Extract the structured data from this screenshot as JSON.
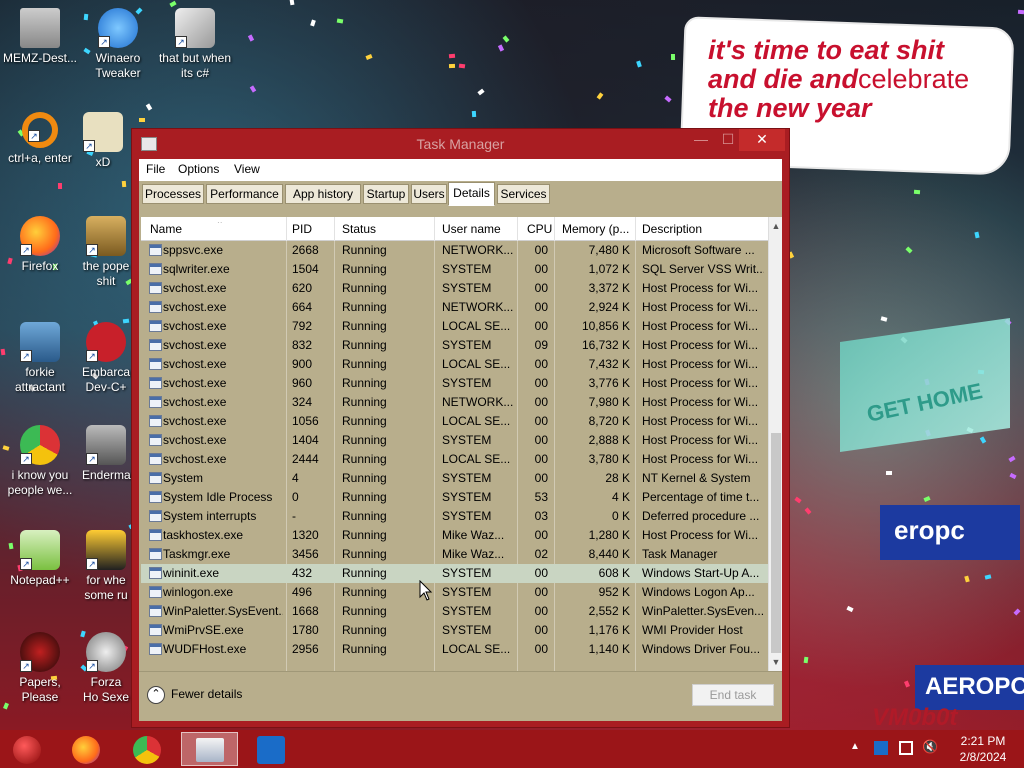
{
  "desktop": {
    "icons": [
      {
        "label": "MEMZ-Dest...",
        "icon": "recycle-bin-icon"
      },
      {
        "label": "Winaero Tweaker",
        "icon": "winaero-icon"
      },
      {
        "label": "that but when its c#",
        "icon": "stacked-windows-icon"
      },
      {
        "label": "ctrl+a, enter",
        "icon": "ring-icon"
      },
      {
        "label": "xD",
        "icon": "hxd-icon"
      },
      {
        "label": "Firefox",
        "icon": "firefox-icon"
      },
      {
        "label": "the pope shit",
        "icon": "pope-icon"
      },
      {
        "label": "forkie attractant",
        "icon": "settings-monitor-icon"
      },
      {
        "label": "Embarca Dev-C+",
        "icon": "devcpp-icon"
      },
      {
        "label": "i know you people we...",
        "icon": "chrome-icon"
      },
      {
        "label": "Enderma",
        "icon": "enderman-icon"
      },
      {
        "label": "Notepad++",
        "icon": "notepad-plus-icon"
      },
      {
        "label": "for whe some ru",
        "icon": "dj-icon"
      },
      {
        "label": "Papers, Please",
        "icon": "papers-please-icon"
      },
      {
        "label": "Forza Ho Sexe",
        "icon": "flash-icon"
      }
    ],
    "wallpaper_text": {
      "line1": "it's time to eat shit",
      "line2a": "and die and",
      "line2b": "celebrate",
      "line3": "the new year",
      "sign1": "GET HOME",
      "sign2": "eropc",
      "sign3": "AEROPOS",
      "watermark": "VM0b0t"
    }
  },
  "window": {
    "title": "Task Manager",
    "controls": {
      "minimize": "—",
      "maximize": "☐",
      "close": "✕"
    },
    "menu": [
      "File",
      "Options",
      "View"
    ],
    "tabs": [
      "Processes",
      "Performance",
      "App history",
      "Startup",
      "Users",
      "Details",
      "Services"
    ],
    "active_tab": "Details",
    "columns": [
      "Name",
      "PID",
      "Status",
      "User name",
      "CPU",
      "Memory (p...",
      "Description"
    ],
    "rows": [
      {
        "name": "sppsvc.exe",
        "pid": "2668",
        "status": "Running",
        "user": "NETWORK...",
        "cpu": "00",
        "memory": "7,480 K",
        "description": "Microsoft Software ..."
      },
      {
        "name": "sqlwriter.exe",
        "pid": "1504",
        "status": "Running",
        "user": "SYSTEM",
        "cpu": "00",
        "memory": "1,072 K",
        "description": "SQL Server VSS Writ..."
      },
      {
        "name": "svchost.exe",
        "pid": "620",
        "status": "Running",
        "user": "SYSTEM",
        "cpu": "00",
        "memory": "3,372 K",
        "description": "Host Process for Wi..."
      },
      {
        "name": "svchost.exe",
        "pid": "664",
        "status": "Running",
        "user": "NETWORK...",
        "cpu": "00",
        "memory": "2,924 K",
        "description": "Host Process for Wi..."
      },
      {
        "name": "svchost.exe",
        "pid": "792",
        "status": "Running",
        "user": "LOCAL SE...",
        "cpu": "00",
        "memory": "10,856 K",
        "description": "Host Process for Wi..."
      },
      {
        "name": "svchost.exe",
        "pid": "832",
        "status": "Running",
        "user": "SYSTEM",
        "cpu": "09",
        "memory": "16,732 K",
        "description": "Host Process for Wi..."
      },
      {
        "name": "svchost.exe",
        "pid": "900",
        "status": "Running",
        "user": "LOCAL SE...",
        "cpu": "00",
        "memory": "7,432 K",
        "description": "Host Process for Wi..."
      },
      {
        "name": "svchost.exe",
        "pid": "960",
        "status": "Running",
        "user": "SYSTEM",
        "cpu": "00",
        "memory": "3,776 K",
        "description": "Host Process for Wi..."
      },
      {
        "name": "svchost.exe",
        "pid": "324",
        "status": "Running",
        "user": "NETWORK...",
        "cpu": "00",
        "memory": "7,980 K",
        "description": "Host Process for Wi..."
      },
      {
        "name": "svchost.exe",
        "pid": "1056",
        "status": "Running",
        "user": "LOCAL SE...",
        "cpu": "00",
        "memory": "8,720 K",
        "description": "Host Process for Wi..."
      },
      {
        "name": "svchost.exe",
        "pid": "1404",
        "status": "Running",
        "user": "SYSTEM",
        "cpu": "00",
        "memory": "2,888 K",
        "description": "Host Process for Wi..."
      },
      {
        "name": "svchost.exe",
        "pid": "2444",
        "status": "Running",
        "user": "LOCAL SE...",
        "cpu": "00",
        "memory": "3,780 K",
        "description": "Host Process for Wi..."
      },
      {
        "name": "System",
        "pid": "4",
        "status": "Running",
        "user": "SYSTEM",
        "cpu": "00",
        "memory": "28 K",
        "description": "NT Kernel & System"
      },
      {
        "name": "System Idle Process",
        "pid": "0",
        "status": "Running",
        "user": "SYSTEM",
        "cpu": "53",
        "memory": "4 K",
        "description": "Percentage of time t..."
      },
      {
        "name": "System interrupts",
        "pid": "-",
        "status": "Running",
        "user": "SYSTEM",
        "cpu": "03",
        "memory": "0 K",
        "description": "Deferred procedure ..."
      },
      {
        "name": "taskhostex.exe",
        "pid": "1320",
        "status": "Running",
        "user": "Mike Waz...",
        "cpu": "00",
        "memory": "1,280 K",
        "description": "Host Process for Wi..."
      },
      {
        "name": "Taskmgr.exe",
        "pid": "3456",
        "status": "Running",
        "user": "Mike Waz...",
        "cpu": "02",
        "memory": "8,440 K",
        "description": "Task Manager"
      },
      {
        "name": "wininit.exe",
        "pid": "432",
        "status": "Running",
        "user": "SYSTEM",
        "cpu": "00",
        "memory": "608 K",
        "description": "Windows Start-Up A..."
      },
      {
        "name": "winlogon.exe",
        "pid": "496",
        "status": "Running",
        "user": "SYSTEM",
        "cpu": "00",
        "memory": "952 K",
        "description": "Windows Logon Ap..."
      },
      {
        "name": "WinPaletter.SysEvent...",
        "pid": "1668",
        "status": "Running",
        "user": "SYSTEM",
        "cpu": "00",
        "memory": "2,552 K",
        "description": "WinPaletter.SysEven..."
      },
      {
        "name": "WmiPrvSE.exe",
        "pid": "1780",
        "status": "Running",
        "user": "SYSTEM",
        "cpu": "00",
        "memory": "1,176 K",
        "description": "WMI Provider Host"
      },
      {
        "name": "WUDFHost.exe",
        "pid": "2956",
        "status": "Running",
        "user": "LOCAL SE...",
        "cpu": "00",
        "memory": "1,140 K",
        "description": "Windows Driver Fou..."
      }
    ],
    "selected_row_name": "wininit.exe",
    "footer": {
      "fewer_details": "Fewer details",
      "end_task": "End task"
    }
  },
  "taskbar": {
    "apps": [
      "start-orb-icon",
      "firefox-icon",
      "chrome-icon",
      "task-manager-icon",
      "outlook-icon"
    ],
    "active_app": "task-manager-icon",
    "tray_icons": [
      "chevron-up-icon",
      "outlook-tray-icon",
      "network-icon",
      "volume-muted-icon"
    ],
    "clock": {
      "time": "2:21 PM",
      "date": "2/8/2024"
    }
  },
  "colors": {
    "accent": "#a91d22",
    "taskbar": "#9b1518",
    "window_body": "#b8ae8c"
  }
}
